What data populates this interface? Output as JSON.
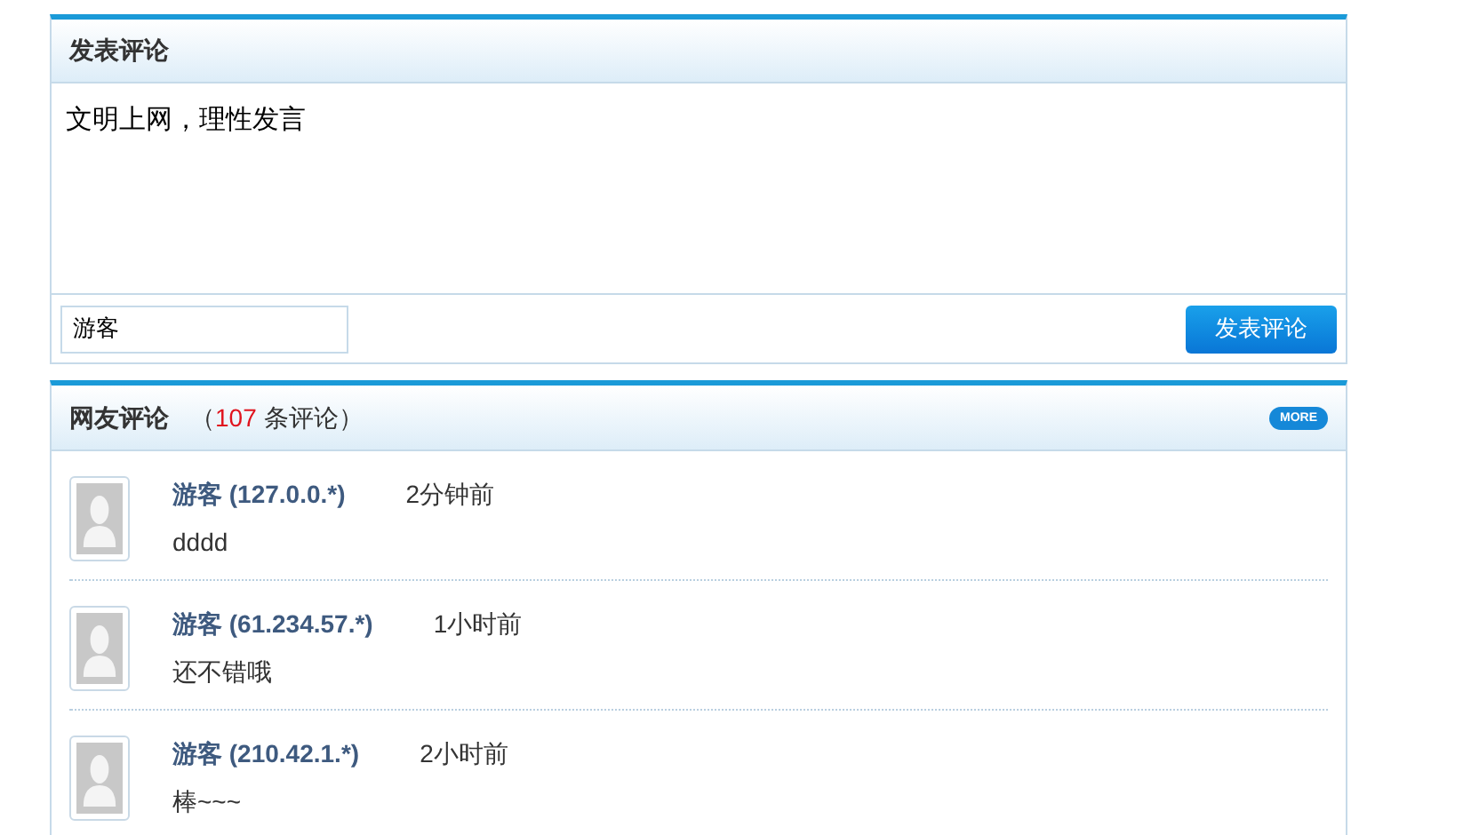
{
  "post_panel": {
    "title": "发表评论",
    "comment_field": {
      "value": "文明上网，理性发言"
    },
    "name_field": {
      "value": "游客"
    },
    "submit_button": "发表评论"
  },
  "comments_panel": {
    "title": "网友评论",
    "count_prefix": "（",
    "count": "107",
    "count_suffix": "条评论）",
    "more_button": "MORE",
    "comments": [
      {
        "author": "游客 (127.0.0.*)",
        "time": "2分钟前",
        "text": "dddd"
      },
      {
        "author": "游客 (61.234.57.*)",
        "time": "1小时前",
        "text": "还不错哦"
      },
      {
        "author": "游客 (210.42.1.*)",
        "time": "2小时前",
        "text": "棒~~~"
      }
    ]
  }
}
